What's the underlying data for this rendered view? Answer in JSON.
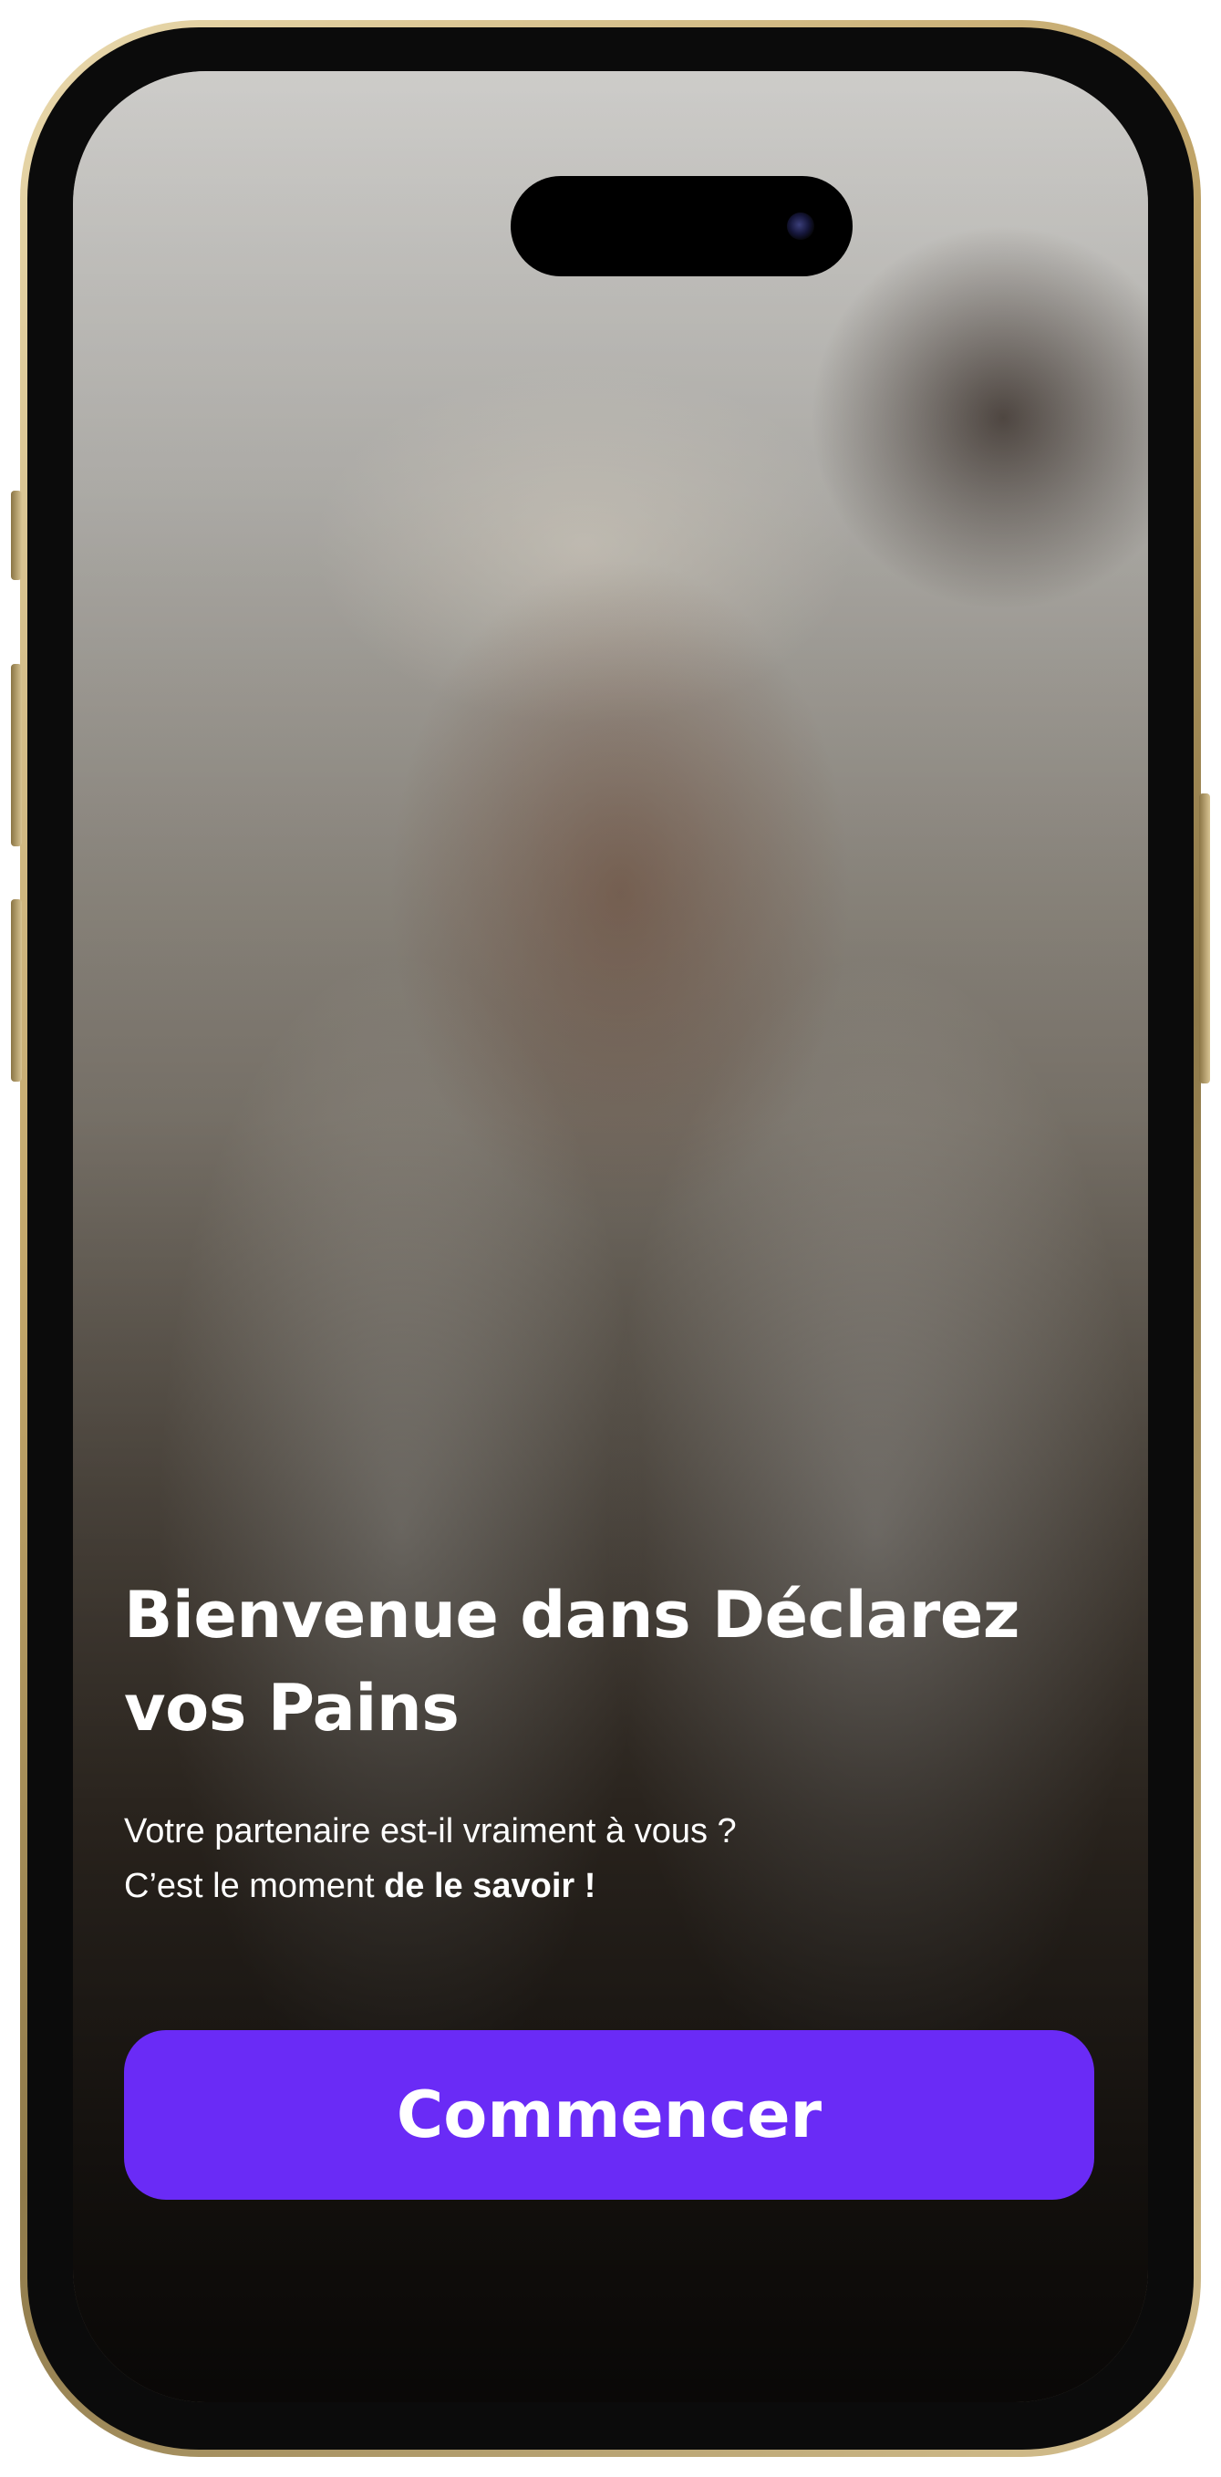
{
  "welcome": {
    "title_line1": "Bienvenue dans Déclarez",
    "title_line2": "vos Pains",
    "subtitle_line1": "Votre partenaire est-il vraiment à vous ?",
    "subtitle_line2_prefix": "C’est le moment ",
    "subtitle_line2_bold": "de le savoir !"
  },
  "cta": {
    "label": "Commencer"
  },
  "colors": {
    "accent": "#6a2bf6",
    "text": "#ffffff",
    "device_frame": "#c2a66a"
  }
}
